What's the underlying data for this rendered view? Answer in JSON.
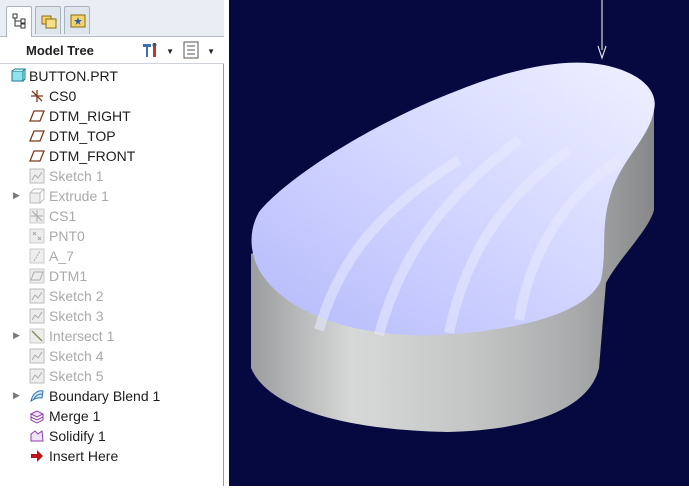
{
  "tabs": [
    {
      "name": "model-tree-tab",
      "active": true
    },
    {
      "name": "folder-browser-tab",
      "active": false
    },
    {
      "name": "favorites-tab",
      "active": false
    }
  ],
  "header": {
    "title": "Model Tree"
  },
  "tree": {
    "items": [
      {
        "label": "BUTTON.PRT",
        "icon": "part-icon"
      },
      {
        "label": "CS0",
        "icon": "coordinate-system-icon"
      },
      {
        "label": "DTM_RIGHT",
        "icon": "datum-plane-icon"
      },
      {
        "label": "DTM_TOP",
        "icon": "datum-plane-icon"
      },
      {
        "label": "DTM_FRONT",
        "icon": "datum-plane-icon"
      },
      {
        "label": "Sketch 1",
        "icon": "sketch-icon"
      },
      {
        "label": "Extrude 1",
        "icon": "extrude-icon"
      },
      {
        "label": "CS1",
        "icon": "coordinate-system-icon"
      },
      {
        "label": "PNT0",
        "icon": "datum-point-icon"
      },
      {
        "label": "A_7",
        "icon": "datum-axis-icon"
      },
      {
        "label": "DTM1",
        "icon": "datum-plane-icon"
      },
      {
        "label": "Sketch 2",
        "icon": "sketch-icon"
      },
      {
        "label": "Sketch 3",
        "icon": "sketch-icon"
      },
      {
        "label": "Intersect 1",
        "icon": "intersect-icon"
      },
      {
        "label": "Sketch 4",
        "icon": "sketch-icon"
      },
      {
        "label": "Sketch 5",
        "icon": "sketch-icon"
      },
      {
        "label": "Boundary Blend 1",
        "icon": "boundary-blend-icon"
      },
      {
        "label": "Merge 1",
        "icon": "merge-icon"
      },
      {
        "label": "Solidify 1",
        "icon": "solidify-icon"
      },
      {
        "label": "Insert Here",
        "icon": "insert-arrow-icon"
      }
    ]
  },
  "viewport": {
    "background": "#050940",
    "model_top_color": "#c9cdff",
    "model_side_color": "#c7c7c7"
  }
}
